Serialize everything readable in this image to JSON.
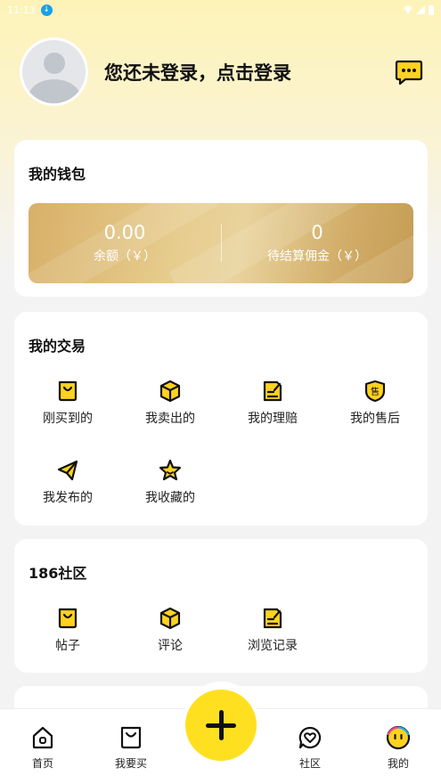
{
  "status_bar": {
    "time": "11:13"
  },
  "profile": {
    "login_prompt": "您还未登录，点击登录"
  },
  "wallet": {
    "title": "我的钱包",
    "balance_value": "0.00",
    "balance_label": "余额（￥）",
    "pending_value": "0",
    "pending_label": "待结算佣金（￥）"
  },
  "trade": {
    "title": "我的交易",
    "items": [
      {
        "label": "刚买到的",
        "icon": "bag-icon"
      },
      {
        "label": "我卖出的",
        "icon": "box-icon"
      },
      {
        "label": "我的理赔",
        "icon": "note-icon"
      },
      {
        "label": "我的售后",
        "icon": "shield-icon",
        "badge": "售"
      },
      {
        "label": "我发布的",
        "icon": "paper-plane-icon"
      },
      {
        "label": "我收藏的",
        "icon": "star-icon"
      }
    ]
  },
  "community": {
    "title": "186社区",
    "items": [
      {
        "label": "帖子",
        "icon": "bag-icon"
      },
      {
        "label": "评论",
        "icon": "box-icon"
      },
      {
        "label": "浏览记录",
        "icon": "note-icon"
      }
    ]
  },
  "bottom_nav": {
    "items": [
      {
        "label": "首页",
        "icon": "home-icon"
      },
      {
        "label": "我要买",
        "icon": "bag-icon"
      },
      {
        "label": "社区",
        "icon": "heart-chat-icon"
      },
      {
        "label": "我的",
        "icon": "face-icon"
      }
    ]
  },
  "colors": {
    "accent": "#ffe021",
    "gold": "#d8b068",
    "icon_fill": "#ffd21f"
  }
}
